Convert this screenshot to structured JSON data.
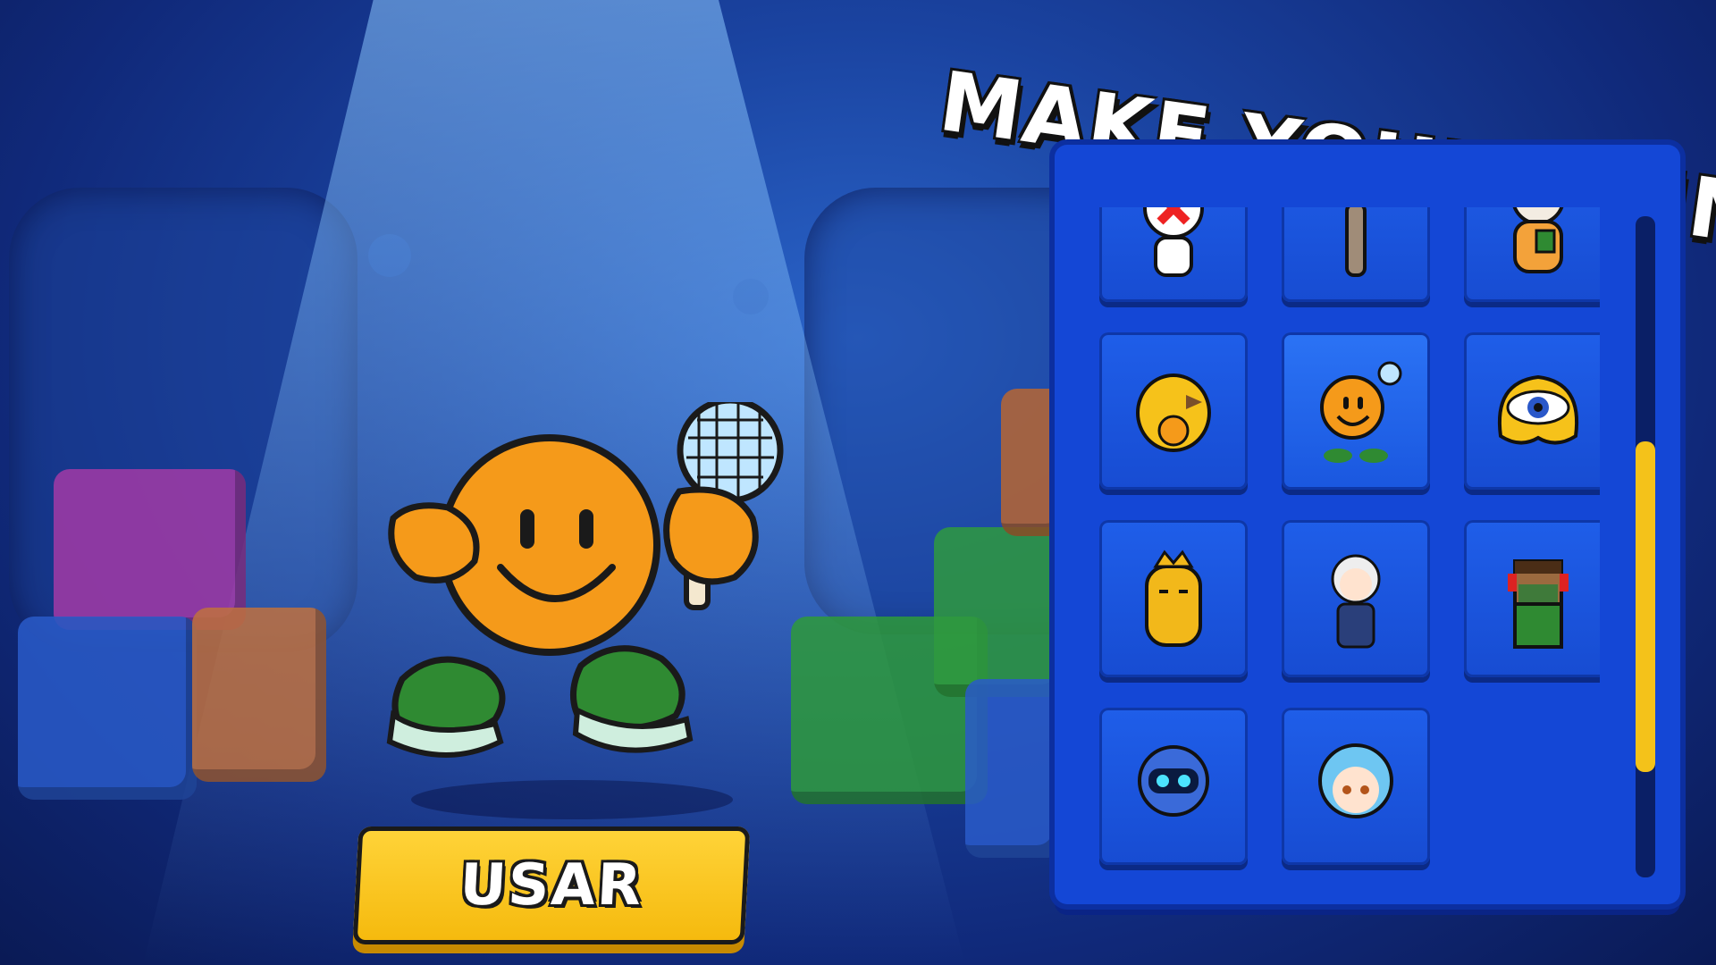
{
  "title": "MAKE YOUR SKIN",
  "use_button": {
    "label": "USAR"
  },
  "selected_skin": "smiley-singer-icon",
  "skins": [
    {
      "icon": "white-masked-character-icon"
    },
    {
      "icon": "ostrich-icon"
    },
    {
      "icon": "polar-bear-with-cup-icon"
    },
    {
      "icon": "yellow-bird-icon"
    },
    {
      "icon": "smiley-singer-icon"
    },
    {
      "icon": "yellow-eye-blob-icon"
    },
    {
      "icon": "yellow-crowned-character-icon"
    },
    {
      "icon": "anime-boy-icon"
    },
    {
      "icon": "pixel-gamer-icon"
    },
    {
      "icon": "robot-icon"
    },
    {
      "icon": "anime-girl-icon"
    }
  ],
  "scroll": {
    "position": 0.68
  },
  "colors": {
    "panel": "#1447d6",
    "button": "#f5b90c",
    "background": "#10297a",
    "character": "#f59a1a",
    "shoes": "#2f8a32"
  }
}
